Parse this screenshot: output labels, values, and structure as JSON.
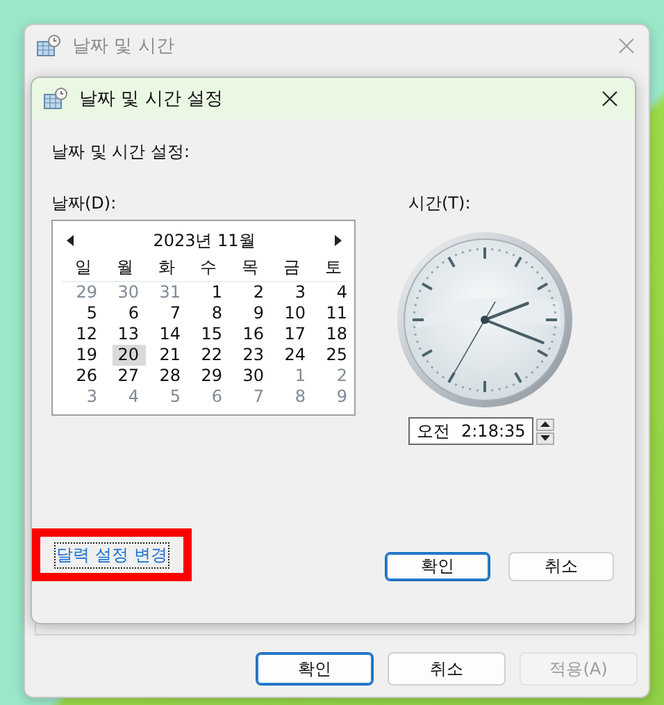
{
  "outer_window": {
    "title": "날짜 및 시간",
    "buttons": [
      {
        "label": "확인",
        "disabled": false,
        "default": true
      },
      {
        "label": "취소",
        "disabled": false,
        "default": false
      },
      {
        "label": "적용(A)",
        "disabled": true,
        "default": false
      }
    ]
  },
  "dialog": {
    "title": "날짜 및 시간 설정",
    "heading": "날짜 및 시간 설정:",
    "date_label": "날짜(D):",
    "time_label": "시간(T):",
    "calendar": {
      "month": "2023년 11월",
      "weekdays": [
        "일",
        "월",
        "화",
        "수",
        "목",
        "금",
        "토"
      ],
      "weeks": [
        [
          {
            "label": "29",
            "other_month": true,
            "selected": false
          },
          {
            "label": "30",
            "other_month": true,
            "selected": false
          },
          {
            "label": "31",
            "other_month": true,
            "selected": false
          },
          {
            "label": "1",
            "other_month": false,
            "selected": false
          },
          {
            "label": "2",
            "other_month": false,
            "selected": false
          },
          {
            "label": "3",
            "other_month": false,
            "selected": false
          },
          {
            "label": "4",
            "other_month": false,
            "selected": false
          }
        ],
        [
          {
            "label": "5",
            "other_month": false,
            "selected": false
          },
          {
            "label": "6",
            "other_month": false,
            "selected": false
          },
          {
            "label": "7",
            "other_month": false,
            "selected": false
          },
          {
            "label": "8",
            "other_month": false,
            "selected": false
          },
          {
            "label": "9",
            "other_month": false,
            "selected": false
          },
          {
            "label": "10",
            "other_month": false,
            "selected": false
          },
          {
            "label": "11",
            "other_month": false,
            "selected": false
          }
        ],
        [
          {
            "label": "12",
            "other_month": false,
            "selected": false
          },
          {
            "label": "13",
            "other_month": false,
            "selected": false
          },
          {
            "label": "14",
            "other_month": false,
            "selected": false
          },
          {
            "label": "15",
            "other_month": false,
            "selected": false
          },
          {
            "label": "16",
            "other_month": false,
            "selected": false
          },
          {
            "label": "17",
            "other_month": false,
            "selected": false
          },
          {
            "label": "18",
            "other_month": false,
            "selected": false
          }
        ],
        [
          {
            "label": "19",
            "other_month": false,
            "selected": false
          },
          {
            "label": "20",
            "other_month": false,
            "selected": true
          },
          {
            "label": "21",
            "other_month": false,
            "selected": false
          },
          {
            "label": "22",
            "other_month": false,
            "selected": false
          },
          {
            "label": "23",
            "other_month": false,
            "selected": false
          },
          {
            "label": "24",
            "other_month": false,
            "selected": false
          },
          {
            "label": "25",
            "other_month": false,
            "selected": false
          }
        ],
        [
          {
            "label": "26",
            "other_month": false,
            "selected": false
          },
          {
            "label": "27",
            "other_month": false,
            "selected": false
          },
          {
            "label": "28",
            "other_month": false,
            "selected": false
          },
          {
            "label": "29",
            "other_month": false,
            "selected": false
          },
          {
            "label": "30",
            "other_month": false,
            "selected": false
          },
          {
            "label": "1",
            "other_month": true,
            "selected": false
          },
          {
            "label": "2",
            "other_month": true,
            "selected": false
          }
        ],
        [
          {
            "label": "3",
            "other_month": true,
            "selected": false
          },
          {
            "label": "4",
            "other_month": true,
            "selected": false
          },
          {
            "label": "5",
            "other_month": true,
            "selected": false
          },
          {
            "label": "6",
            "other_month": true,
            "selected": false
          },
          {
            "label": "7",
            "other_month": true,
            "selected": false
          },
          {
            "label": "8",
            "other_month": true,
            "selected": false
          },
          {
            "label": "9",
            "other_month": true,
            "selected": false
          }
        ]
      ]
    },
    "time": {
      "period": "오전",
      "value": "2:18:35"
    },
    "link": {
      "text": "달력 설정 변경",
      "highlighted": true
    },
    "buttons": [
      {
        "label": "확인",
        "default": true
      },
      {
        "label": "취소",
        "default": false
      }
    ]
  }
}
